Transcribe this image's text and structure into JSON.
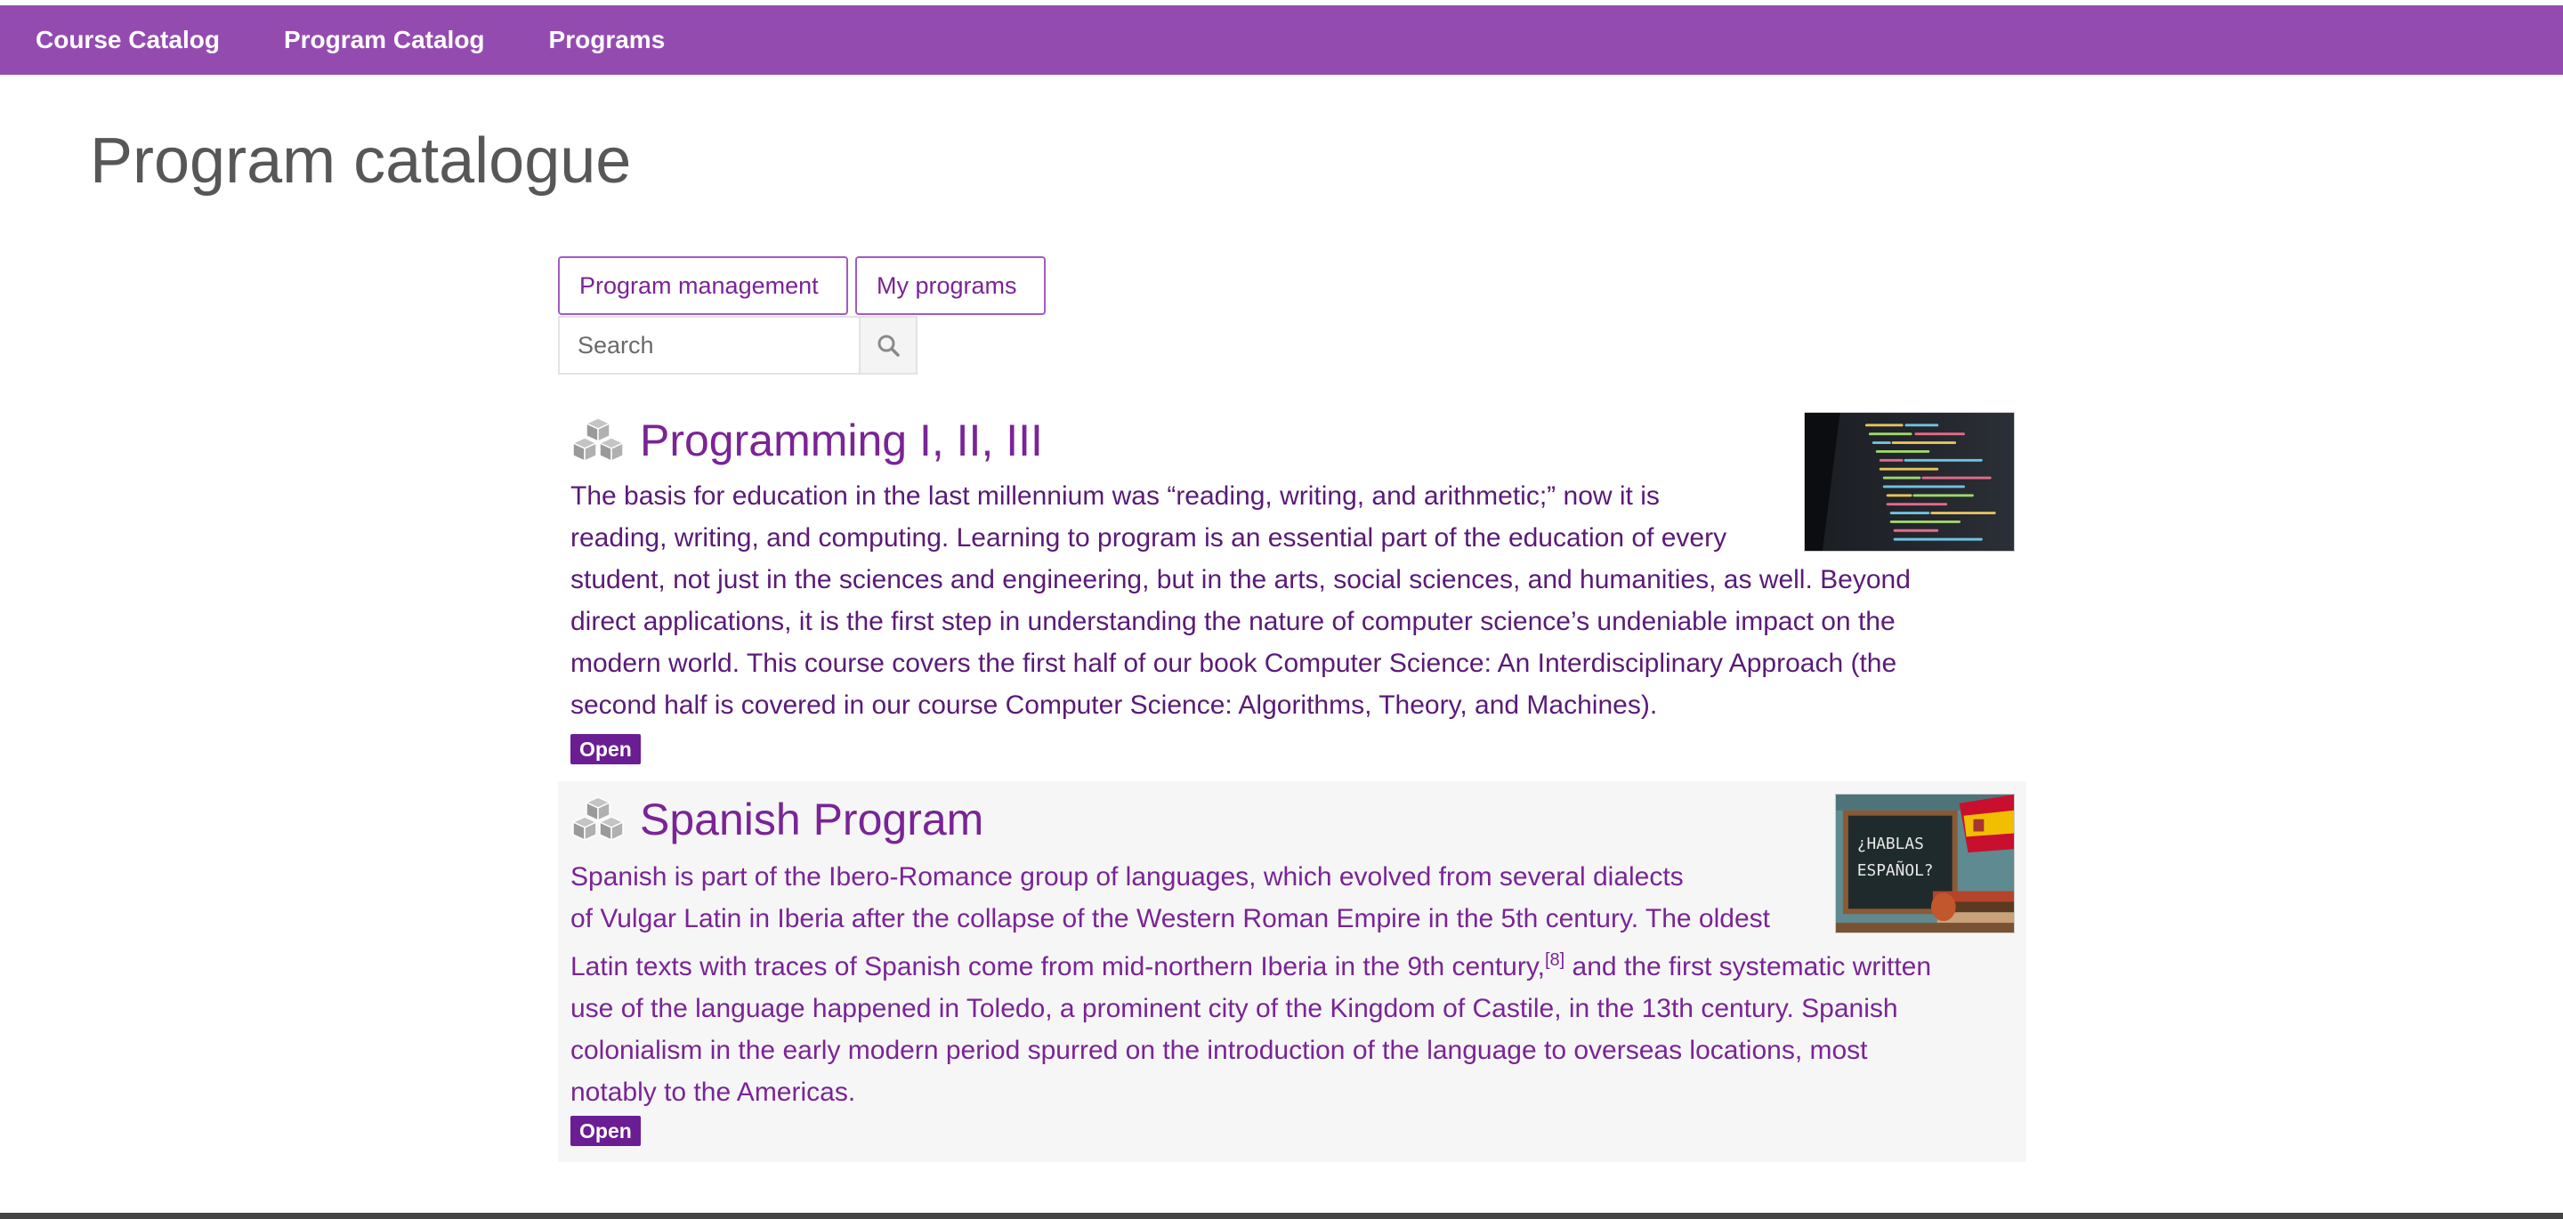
{
  "nav": {
    "items": [
      {
        "label": "Course Catalog"
      },
      {
        "label": "Program Catalog"
      },
      {
        "label": "Programs"
      }
    ]
  },
  "page": {
    "title": "Program catalogue"
  },
  "actions": {
    "program_management": "Program management",
    "my_programs": "My programs"
  },
  "search": {
    "placeholder": "Search",
    "icon": "search-icon"
  },
  "programs": [
    {
      "title": "Programming I, II, III",
      "icon": "cubes-icon",
      "description_lines": [
        "The basis for education in the last millennium was “reading, writing, and arithmetic;” now it is",
        "reading, writing, and computing. Learning to program is an essential part of the education of every",
        "student, not just in the sciences and engineering, but in the arts, social sciences, and humanities, as well. Beyond",
        "direct applications, it is the first step in understanding the nature of computer science’s undeniable impact on the",
        "modern world. This course covers the first half of our book Computer Science: An Interdisciplinary Approach (the",
        "second half is covered in our course Computer Science: Algorithms, Theory, and Machines)."
      ],
      "status": "Open"
    },
    {
      "title": "Spanish Program",
      "icon": "cubes-icon",
      "description_lines": [
        "Spanish is part of the Ibero-Romance group of languages, which evolved from several dialects",
        "of Vulgar Latin in Iberia after the collapse of the Western Roman Empire in the 5th century. The oldest",
        "Latin texts with traces of Spanish come from mid-northern Iberia in the 9th century,",
        "use of the language happened in Toledo, a prominent city of the Kingdom of Castile, in the 13th century. Spanish",
        "colonialism in the early modern period spurred on the introduction of the language to overseas locations, most",
        "notably to the Americas."
      ],
      "footnote": "[8]",
      "line3_tail": " and the first systematic written",
      "thumb_text": [
        "¿HABLAS",
        "ESPAÑOL?"
      ],
      "status": "Open"
    }
  ],
  "colors": {
    "topbar": "#944bb0",
    "accent": "#7a2496",
    "badge": "#6b1d94"
  }
}
